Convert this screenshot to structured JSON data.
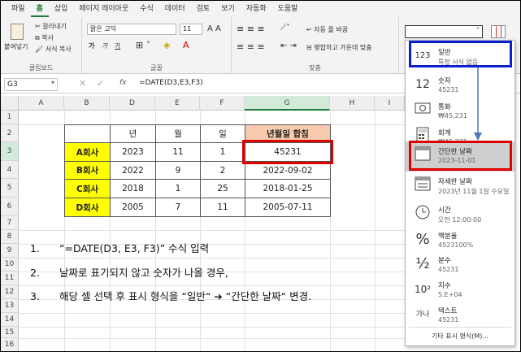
{
  "ribbon_tabs": [
    "파일",
    "홈",
    "삽입",
    "페이지 레이아웃",
    "수식",
    "데이터",
    "검토",
    "보기",
    "자동화",
    "도움말"
  ],
  "ribbon": {
    "paste": "붙여넣기",
    "cut": "잘라내기",
    "copy": "복사",
    "format_painter": "서식 복사",
    "clipboard_label": "클립보드",
    "font_name": "맑은 고딕",
    "font_size": "11",
    "font_label": "글꼴",
    "wrap": "자동 줄 바꿈",
    "merge": "병합하고 가운데 맞춤",
    "align_label": "맞춤",
    "bold": "가",
    "italic": "가",
    "underline": "가"
  },
  "formula_bar": {
    "name_box": "G3",
    "fx": "fx",
    "formula": "=DATE(D3,E3,F3)"
  },
  "columns": [
    "A",
    "B",
    "D",
    "E",
    "F",
    "G",
    "H",
    "I"
  ],
  "rows": [
    "1",
    "2",
    "3",
    "4",
    "5",
    "6",
    "7",
    "8",
    "9",
    "10",
    "11",
    "12",
    "13",
    "14",
    "15",
    "16"
  ],
  "table": {
    "headers": [
      "년",
      "월",
      "일",
      "년월일 합침"
    ],
    "rows": [
      {
        "name": "A회사",
        "year": "2023",
        "month": "11",
        "day": "1",
        "result": "45231"
      },
      {
        "name": "B회사",
        "year": "2022",
        "month": "9",
        "day": "2",
        "result": "2022-09-02"
      },
      {
        "name": "C회사",
        "year": "2018",
        "month": "1",
        "day": "25",
        "result": "2018-01-25"
      },
      {
        "name": "D회사",
        "year": "2005",
        "month": "7",
        "day": "11",
        "result": "2005-07-11"
      }
    ]
  },
  "steps": [
    {
      "num": "1.",
      "text": "“=DATE(D3, E3, F3)” 수식 입력"
    },
    {
      "num": "2.",
      "text": "날짜로 표기되지 않고 숫자가 나올 경우,"
    },
    {
      "num": "3.",
      "text": "해당 셀  선택 후 표시 형식을 “일반“ ➔ “간단한 날짜“ 변경."
    }
  ],
  "format_menu": [
    {
      "name": "일반",
      "sub": "특정 서식 없음",
      "icon": "clock-123-icon",
      "glyph": "123"
    },
    {
      "name": "숫자",
      "sub": "45231",
      "icon": "number-12-icon",
      "glyph": "12"
    },
    {
      "name": "통화",
      "sub": "₩45,231",
      "icon": "currency-icon",
      "glyph": ""
    },
    {
      "name": "회계",
      "sub": "₩45,231",
      "icon": "accounting-icon",
      "glyph": ""
    },
    {
      "name": "간단한 날짜",
      "sub": "2023-11-01",
      "icon": "calendar-icon",
      "glyph": ""
    },
    {
      "name": "자세한 날짜",
      "sub": "2023년 11월 1일 수요일",
      "icon": "calendar-long-icon",
      "glyph": ""
    },
    {
      "name": "시간",
      "sub": "오전 12:00:00",
      "icon": "clock-icon",
      "glyph": ""
    },
    {
      "name": "백분율",
      "sub": "4523100%",
      "icon": "percent-icon",
      "glyph": "%"
    },
    {
      "name": "분수",
      "sub": "45231",
      "icon": "fraction-icon",
      "glyph": "½"
    },
    {
      "name": "지수",
      "sub": "5.E+04",
      "icon": "scientific-icon",
      "glyph": "10²"
    },
    {
      "name": "텍스트",
      "sub": "45231",
      "icon": "text-icon",
      "glyph": "가나"
    }
  ],
  "more_formats": "기타 표시 형식(M)...",
  "colors": {
    "accent": "#1b7b3a",
    "highlight_red": "#dd0000",
    "highlight_blue": "#0b1fcf",
    "yellow": "#ffff00",
    "peach": "#f8cbad"
  }
}
